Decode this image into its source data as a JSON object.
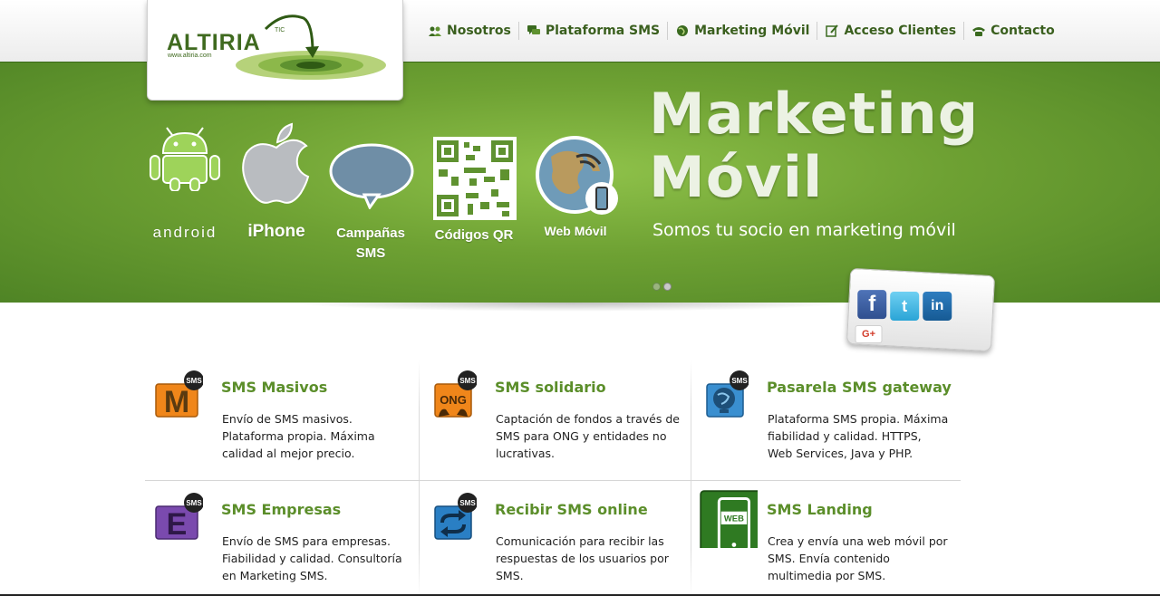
{
  "logo": {
    "name": "ALTIRIA",
    "tic": "TIC",
    "url": "www.altiria.com"
  },
  "nav": {
    "items": [
      {
        "label": "Nosotros",
        "icon": "users-icon"
      },
      {
        "label": "Plataforma SMS",
        "icon": "chat-bubbles-icon"
      },
      {
        "label": "Marketing Móvil",
        "icon": "globe-icon"
      },
      {
        "label": "Acceso Clientes",
        "icon": "edit-icon"
      },
      {
        "label": "Contacto",
        "icon": "phone-icon"
      }
    ]
  },
  "banner": {
    "title_line1": "Marketing",
    "title_line2": "Móvil",
    "subtitle": "Somos tu socio en marketing móvil",
    "items": [
      {
        "label": "android",
        "icon": "android-icon"
      },
      {
        "label": "iPhone",
        "icon": "apple-icon"
      },
      {
        "label_line1": "Campañas",
        "label_line2": "SMS",
        "icon": "speech-bubble-icon"
      },
      {
        "label": "Códigos QR",
        "icon": "qr-code-icon"
      },
      {
        "label": "Web Móvil",
        "icon": "globe-signal-icon"
      }
    ],
    "slides": 2,
    "active_slide": 2
  },
  "social": {
    "facebook": "f",
    "twitter": "t",
    "linkedin": "in",
    "googleplus": "G+"
  },
  "services": [
    {
      "title": "SMS Masivos",
      "icon_letter": "M",
      "badge": "SMS",
      "color": "#f0861a",
      "lines": [
        "Envío de SMS masivos.",
        "Plataforma propia. Máxima",
        "calidad al mejor precio."
      ]
    },
    {
      "title": "SMS solidario",
      "icon_letter": "ONG",
      "badge": "SMS",
      "color": "#f0861a",
      "lines": [
        "Captación de fondos a través de",
        "SMS para ONG y entidades no",
        "lucrativas."
      ]
    },
    {
      "title": "Pasarela SMS gateway",
      "icon_letter": "",
      "badge": "SMS",
      "color": "#3a8fd0",
      "lines": [
        "Plataforma SMS propia. Máxima",
        "fiabilidad y calidad. HTTPS,",
        "Web Services, Java y PHP."
      ]
    },
    {
      "title": "SMS Empresas",
      "icon_letter": "E",
      "badge": "SMS",
      "color": "#6b3fa0",
      "lines": [
        "Envío de SMS para empresas.",
        "Fiabilidad y calidad. Consultoría",
        "en Marketing SMS."
      ]
    },
    {
      "title": "Recibir SMS online",
      "icon_letter": "",
      "badge": "SMS",
      "color": "#2a7fc4",
      "lines": [
        "Comunicación para recibir las",
        "respuestas de los usuarios por",
        "SMS."
      ]
    },
    {
      "title": "SMS Landing",
      "icon_letter": "WEB",
      "badge": "",
      "color": "#3e8a2a",
      "lines": [
        "Crea y envía una web móvil por",
        "SMS. Envía contenido",
        "multimedia por SMS."
      ]
    }
  ]
}
